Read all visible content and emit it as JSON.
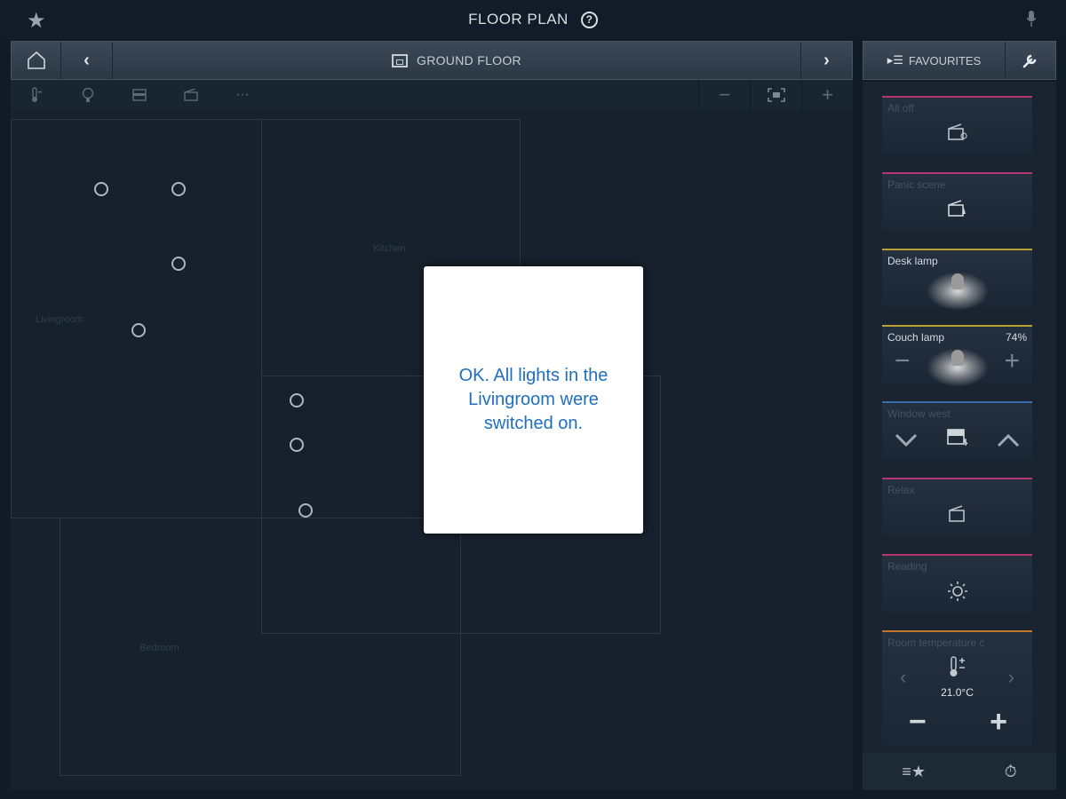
{
  "topbar": {
    "title": "FLOOR PLAN",
    "help_glyph": "?",
    "star_icon": "star-icon",
    "mic_icon": "microphone-icon"
  },
  "floor_header": {
    "floor_name": "GROUND FLOOR",
    "prev_glyph": "‹",
    "next_glyph": "›"
  },
  "toolbar": {
    "zoom_out": "−",
    "fit": "⛶",
    "zoom_in": "+",
    "more": "···"
  },
  "rooms": [
    {
      "label": "Livingroom"
    },
    {
      "label": "Kitchen"
    },
    {
      "label": "Bedroom"
    }
  ],
  "dialog": {
    "message": "OK. All lights in the Livingroom were switched on."
  },
  "favourites": {
    "title": "FAVOURITES",
    "tiles": [
      {
        "label": "All off",
        "accent": "#b5356e"
      },
      {
        "label": "Panic scene",
        "accent": "#b5356e"
      },
      {
        "label": "Desk lamp",
        "accent": "#b5a233"
      },
      {
        "label": "Couch lamp",
        "value": "74%",
        "accent": "#b5a233"
      },
      {
        "label": "Window west",
        "accent": "#3a6ea8"
      },
      {
        "label": "Relax",
        "accent": "#b5356e"
      },
      {
        "label": "Reading",
        "accent": "#b5356e"
      },
      {
        "label": "Room temperature c",
        "value": "21.0°C",
        "accent": "#c2762e"
      }
    ]
  },
  "colors": {
    "background": "#111b27",
    "dialog_text": "#1f6fc0",
    "scene_accent": "#b5356e",
    "light_accent": "#b5a233",
    "shade_accent": "#3a6ea8",
    "temp_accent": "#c2762e"
  }
}
